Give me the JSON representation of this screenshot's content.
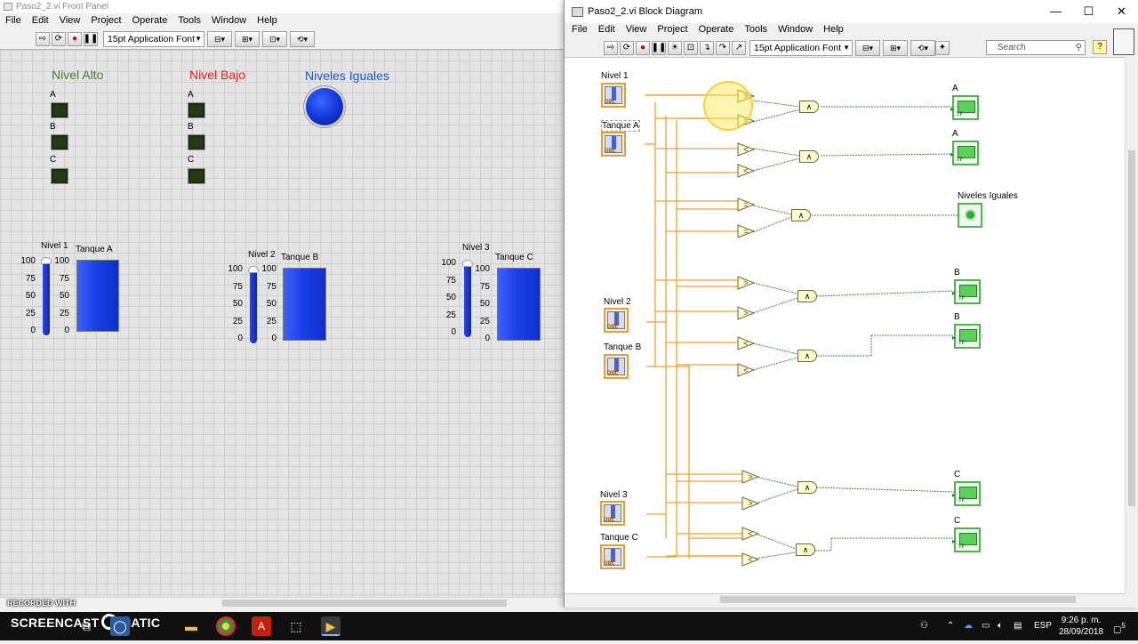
{
  "front_panel": {
    "title": "Paso2_2.vi Front Panel",
    "menu": [
      "File",
      "Edit",
      "View",
      "Project",
      "Operate",
      "Tools",
      "Window",
      "Help"
    ],
    "font_selector": "15pt Application Font",
    "indicator_groups": [
      {
        "title": "Nivel Alto",
        "color": "#4a7a30",
        "leds": [
          "A",
          "B",
          "C"
        ]
      },
      {
        "title": "Nivel Bajo",
        "color": "#e52020",
        "leds": [
          "A",
          "B",
          "C"
        ]
      }
    ],
    "equal_indicator": {
      "title": "Niveles Iguales",
      "color": "#1f56c4"
    },
    "sliders": [
      {
        "label": "Nivel 1",
        "ticks": [
          "100",
          "75",
          "50",
          "25",
          "0"
        ]
      },
      {
        "label": "Nivel 2",
        "ticks": [
          "100",
          "75",
          "50",
          "25",
          "0"
        ]
      },
      {
        "label": "Nivel 3",
        "ticks": [
          "100",
          "75",
          "50",
          "25",
          "0"
        ]
      }
    ],
    "tanks": [
      {
        "label": "Tanque A",
        "ticks": [
          "100",
          "75",
          "50",
          "25",
          "0"
        ]
      },
      {
        "label": "Tanque B",
        "ticks": [
          "100",
          "75",
          "50",
          "25",
          "0"
        ]
      },
      {
        "label": "Tanque C",
        "ticks": [
          "100",
          "75",
          "50",
          "25",
          "0"
        ]
      }
    ],
    "recorded_with": "RECORDED WITH"
  },
  "block_diagram": {
    "title": "Paso2_2.vi Block Diagram",
    "menu": [
      "File",
      "Edit",
      "View",
      "Project",
      "Operate",
      "Tools",
      "Window",
      "Help"
    ],
    "font_selector": "15pt Application Font",
    "search_placeholder": "Search",
    "controls": [
      "Nivel 1",
      "Tanque A",
      "Nivel 2",
      "Tanque B",
      "Nivel 3",
      "Tanque C"
    ],
    "indicators": [
      "A",
      "A",
      "Niveles Iguales",
      "B",
      "B",
      "C",
      "C"
    ],
    "terminal_code": "DBL",
    "indicator_code": "TF",
    "comparators": [
      ">",
      ">",
      "<",
      "<",
      "=",
      "=",
      ">",
      ">",
      "<",
      "<",
      ">",
      ">",
      "<",
      "<"
    ],
    "and_gate": "∧",
    "window_controls": [
      "—",
      "☐",
      "✕"
    ]
  },
  "taskbar": {
    "screencast_label": "SCREENCAST",
    "screencast_suffix": "MATIC",
    "time": "9:26 p. m.",
    "date": "28/09/2018",
    "lang": "ESP",
    "notifications": "5"
  }
}
